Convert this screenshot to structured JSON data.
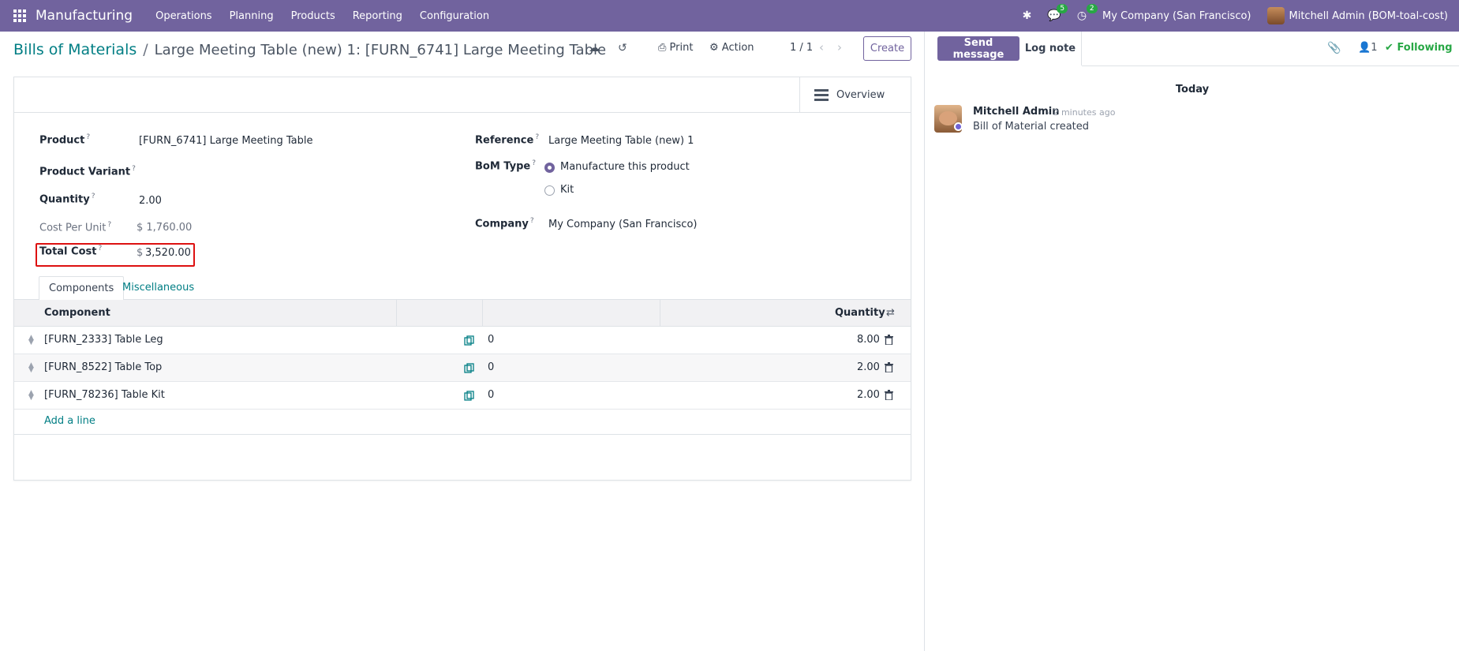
{
  "nav": {
    "app_name": "Manufacturing",
    "menus": [
      "Operations",
      "Planning",
      "Products",
      "Reporting",
      "Configuration"
    ],
    "messages_badge": "5",
    "activities_badge": "2",
    "company": "My Company (San Francisco)",
    "user": "Mitchell Admin (BOM-toal-cost)"
  },
  "control": {
    "breadcrumb_root": "Bills of Materials",
    "breadcrumb_sep": "/",
    "breadcrumb_current": "Large Meeting Table (new) 1: [FURN_6741] Large Meeting Table",
    "print_label": "Print",
    "action_label": "Action",
    "pager": "1 / 1",
    "create_label": "Create"
  },
  "form": {
    "overview_label": "Overview",
    "product_label": "Product",
    "product_value": "[FURN_6741] Large Meeting Table",
    "variant_label": "Product Variant",
    "quantity_label": "Quantity",
    "quantity_value": "2.00",
    "cost_unit_label": "Cost Per Unit",
    "cost_unit_value": "$ 1,760.00",
    "total_cost_label": "Total Cost",
    "total_cost_currency": "$",
    "total_cost_value": "3,520.00",
    "reference_label": "Reference",
    "reference_value": "Large Meeting Table (new) 1",
    "bom_type_label": "BoM Type",
    "bom_type_options": [
      "Manufacture this product",
      "Kit"
    ],
    "company_label": "Company",
    "company_value": "My Company (San Francisco)",
    "help_mark": "?"
  },
  "tabs": [
    "Components",
    "Miscellaneous"
  ],
  "table": {
    "headers": {
      "component": "Component",
      "quantity": "Quantity"
    },
    "rows": [
      {
        "component": "[FURN_2333] Table Leg",
        "mid": "0",
        "quantity": "8.00"
      },
      {
        "component": "[FURN_8522] Table Top",
        "mid": "0",
        "quantity": "2.00"
      },
      {
        "component": "[FURN_78236] Table Kit",
        "mid": "0",
        "quantity": "2.00"
      }
    ],
    "add_line": "Add a line"
  },
  "chatter": {
    "send_message": "Send message",
    "log_note": "Log note",
    "followers": "1",
    "following": "Following",
    "today": "Today",
    "author": "Mitchell Admin",
    "date": "- 2 minutes ago",
    "body": "Bill of Material created"
  },
  "colors": {
    "brand": "#71639e",
    "link": "#017e84",
    "success": "#28a745",
    "highlight": "#dd1111"
  }
}
